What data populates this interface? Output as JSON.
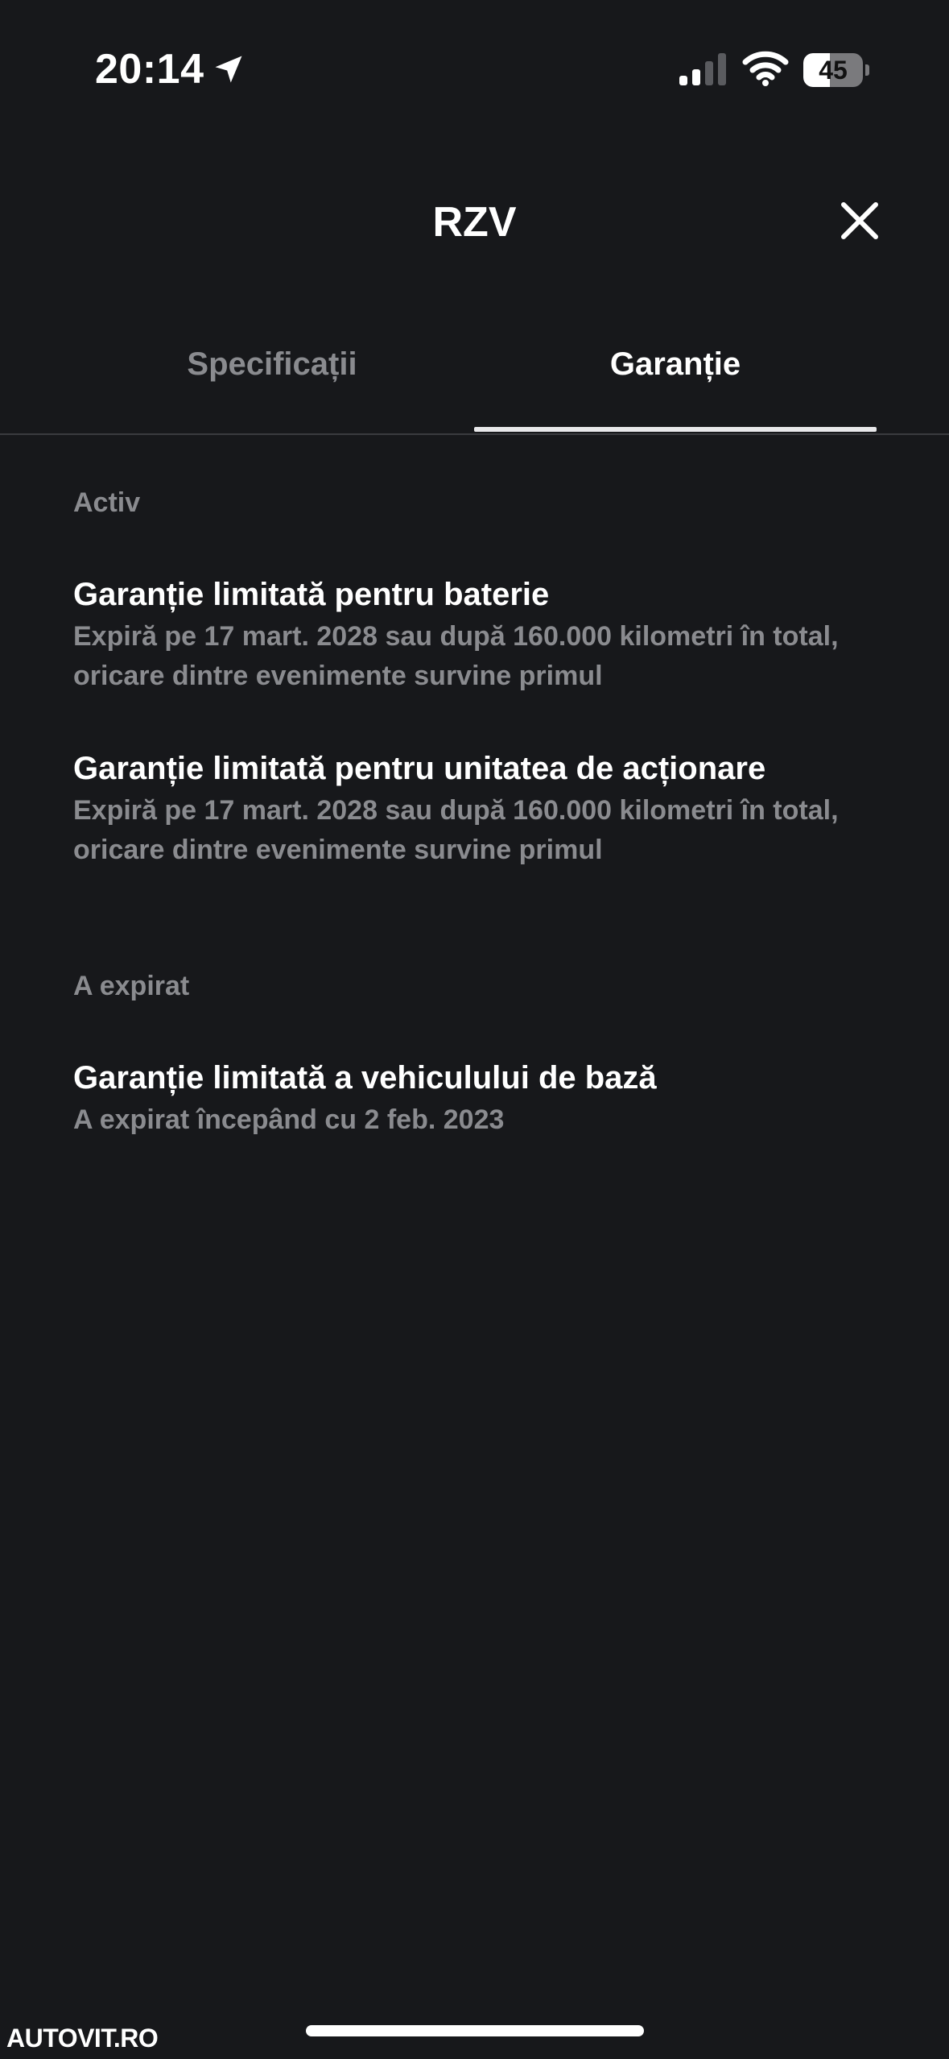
{
  "status_bar": {
    "time": "20:14",
    "battery_level": "45",
    "battery_fraction": 0.45
  },
  "header": {
    "title": "RZV"
  },
  "tabs": [
    {
      "label": "Specificații",
      "active": false
    },
    {
      "label": "Garanție",
      "active": true
    }
  ],
  "sections": {
    "active": {
      "label": "Activ",
      "items": [
        {
          "title": "Garanție limitată pentru baterie",
          "description": "Expiră pe 17 mart. 2028 sau după 160.000 kilometri în total, oricare dintre evenimente survine primul"
        },
        {
          "title": "Garanție limitată pentru unitatea de acționare",
          "description": "Expiră pe 17 mart. 2028 sau după 160.000 kilometri în total, oricare dintre evenimente survine primul"
        }
      ]
    },
    "expired": {
      "label": "A expirat",
      "items": [
        {
          "title": "Garanție limitată a vehiculului de bază",
          "description": "A expirat începând cu 2 feb. 2023"
        }
      ]
    }
  },
  "watermark": {
    "text": "AUTOVIT.RO"
  },
  "colors": {
    "background": "#17181b",
    "text_primary": "#ffffff",
    "text_secondary": "#8a8b8f",
    "divider": "#3a3b3f"
  },
  "icons": {
    "location": "location-arrow-icon",
    "signal": "cellular-signal-icon",
    "wifi": "wifi-icon",
    "close": "close-icon"
  }
}
